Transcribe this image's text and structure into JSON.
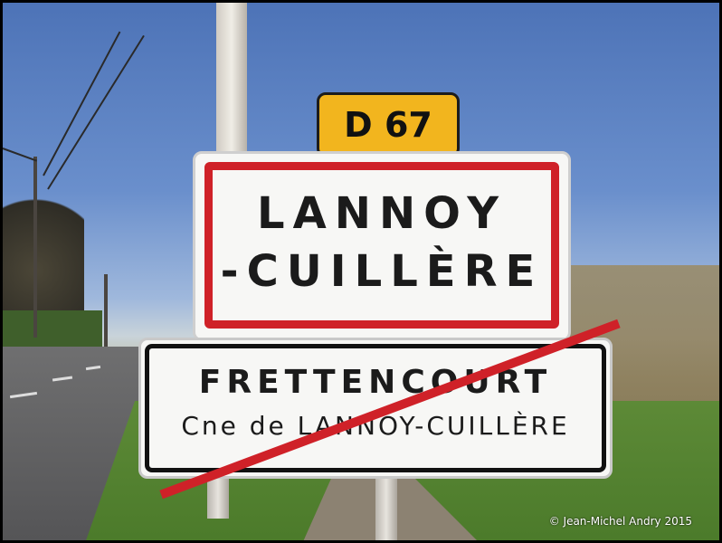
{
  "signs": {
    "route": "D 67",
    "town_line1": "LANNOY",
    "town_line2": "-CUILLÈRE",
    "exit_line1": "FRETTENCOURT",
    "exit_line2": "Cne de LANNOY-CUILLÈRE"
  },
  "credit": "©  Jean-Michel Andry 2015",
  "colors": {
    "sky": "#5b80c2",
    "sign_red": "#cf2128",
    "route_yellow": "#f2b51e",
    "sign_white": "#f7f7f5",
    "grass": "#5d8a37"
  }
}
